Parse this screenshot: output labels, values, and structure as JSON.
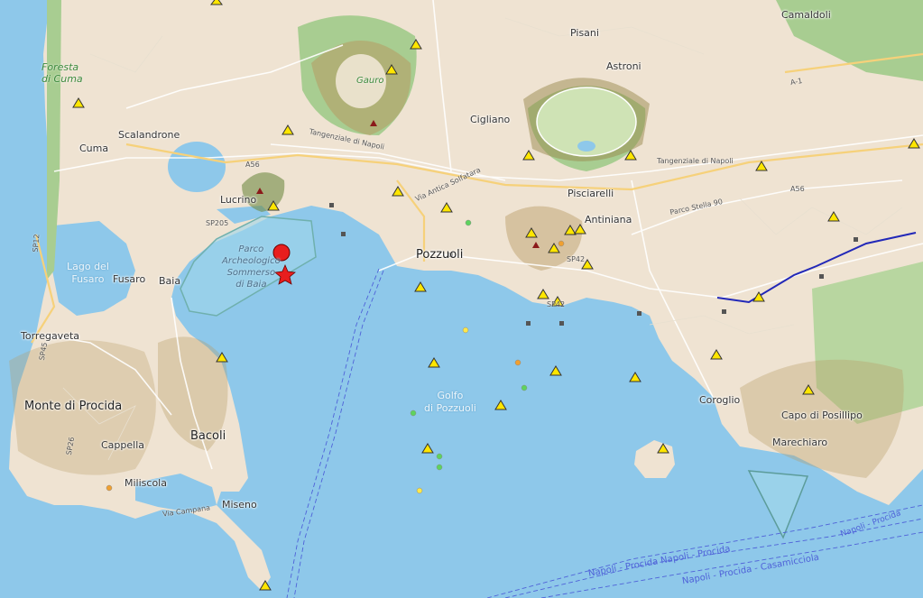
{
  "places": {
    "foresta_di_cuma": "Foresta\ndi Cuma",
    "cuma": "Cuma",
    "scalandrone": "Scalandrone",
    "lucrino": "Lucrino",
    "gauro": "Gauro",
    "pisani": "Pisani",
    "astroni": "Astroni",
    "camaldoli": "Camaldoli",
    "cigliano": "Cigliano",
    "pisciarelli": "Pisciarelli",
    "antiniana": "Antiniana",
    "pozzuoli": "Pozzuoli",
    "lago_del_fusaro": "Lago del\nFusaro",
    "fusaro": "Fusaro",
    "baia": "Baia",
    "torregaveta": "Torregaveta",
    "monte_di_procida": "Monte di Procida",
    "bacoli": "Bacoli",
    "cappella": "Cappella",
    "miliscola": "Miliscola",
    "miseno": "Miseno",
    "golfo_di_pozzuoli": "Golfo\ndi Pozzuoli",
    "parco_sommerso": "Parco\nArcheologico\nSommerso\ndi Baia",
    "coroglio": "Coroglio",
    "capo_di_posillipo": "Capo di Posillipo",
    "marechiaro": "Marechiaro"
  },
  "roads": {
    "tangenziale_1": "Tangenziale di Napoli",
    "tangenziale_2": "Tangenziale di Napoli",
    "via_solfatara": "Via Antica Solfatara",
    "parco_stella": "Parco Stella 90",
    "a56_west": "A56",
    "a56_east": "A56",
    "sp205": "SP205",
    "sp42": "SP42",
    "sp45": "SP45",
    "sp26": "SP26",
    "sp12": "SP12",
    "sp42b": "SP42",
    "campana": "Via Campana",
    "a1": "A-1"
  },
  "ferry_lines": {
    "line1": "Napoli - Procida  Napoli - Procida",
    "line2": "Napoli - Procida - Casamicciola",
    "line3": "Napoli - Procida"
  },
  "colors": {
    "sea": "#8ec8ea",
    "land": "#efe3d2",
    "forest": "#a8cd91",
    "volcano_shade": "#b79a63",
    "quake_marker": "#ffe600",
    "epicenter": "#e81e1e",
    "metro_line": "#2228b8"
  },
  "quake_triangles": 30,
  "quake_dots": 10
}
